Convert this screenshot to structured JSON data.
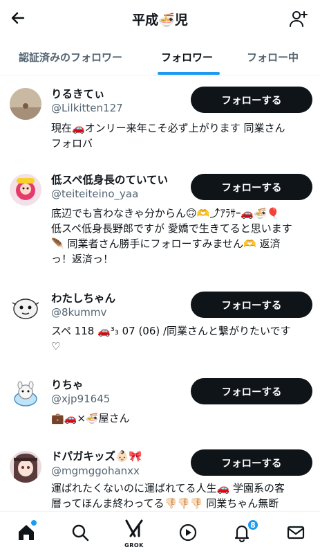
{
  "header": {
    "title": "平成🍜児",
    "back_icon": "arrow-left-icon",
    "add_icon": "person-plus-icon"
  },
  "tabs": [
    {
      "label": "認証済みのフォロワー",
      "active": false
    },
    {
      "label": "フォロワー",
      "active": true
    },
    {
      "label": "フォロー中",
      "active": false
    }
  ],
  "followers": [
    {
      "name": "りるきてぃ",
      "handle": "@Lilkitten127",
      "bio": "現在🚗オンリー来年こそ必ず上がります 同業さん\nフォロバ",
      "button": "フォローする"
    },
    {
      "name": "低スペ低身長のていてい",
      "handle": "@teiteiteino_yaa",
      "bio": "底辺でも言わなきゃ分からん🙃🫶⤴︎ｱﾗｻｰ🚗🍜🎈\n低スペ低身長野郎ですが 愛嬌で生きてると思います\n🪶 同業者さん勝手にフォローすみません🫶 返済\nっ！返済っ！",
      "button": "フォローする"
    },
    {
      "name": "わたしちゃん",
      "handle": "@8kummv",
      "bio": "スペ 118 🚗³₃ 07 (06) /同業さんと繋がりたいです\n♡",
      "button": "フォローする"
    },
    {
      "name": "りちゃ",
      "handle": "@xjp91645",
      "bio": "💼🚗×🍜屋さん",
      "button": "フォローする"
    },
    {
      "name": "ドパガキッズ👶🏻🎀",
      "handle": "@mgmggohanxx",
      "bio": "運ばれたくないのに運ばれてる人生🚗 学園系の客\n層ってほんま終わってる👎🏻👎🏻👎🏻 同業ちゃん無断",
      "button": "フォローする"
    }
  ],
  "bottom_nav": {
    "items": [
      "home-icon",
      "search-icon",
      "grok-icon",
      "play-icon",
      "bell-icon",
      "mail-icon"
    ],
    "grok_label": "GROK",
    "notification_count": "8"
  },
  "colors": {
    "accent": "#1d9bf0",
    "text": "#0f1419",
    "secondary": "#536471",
    "button_bg": "#0f1419"
  }
}
